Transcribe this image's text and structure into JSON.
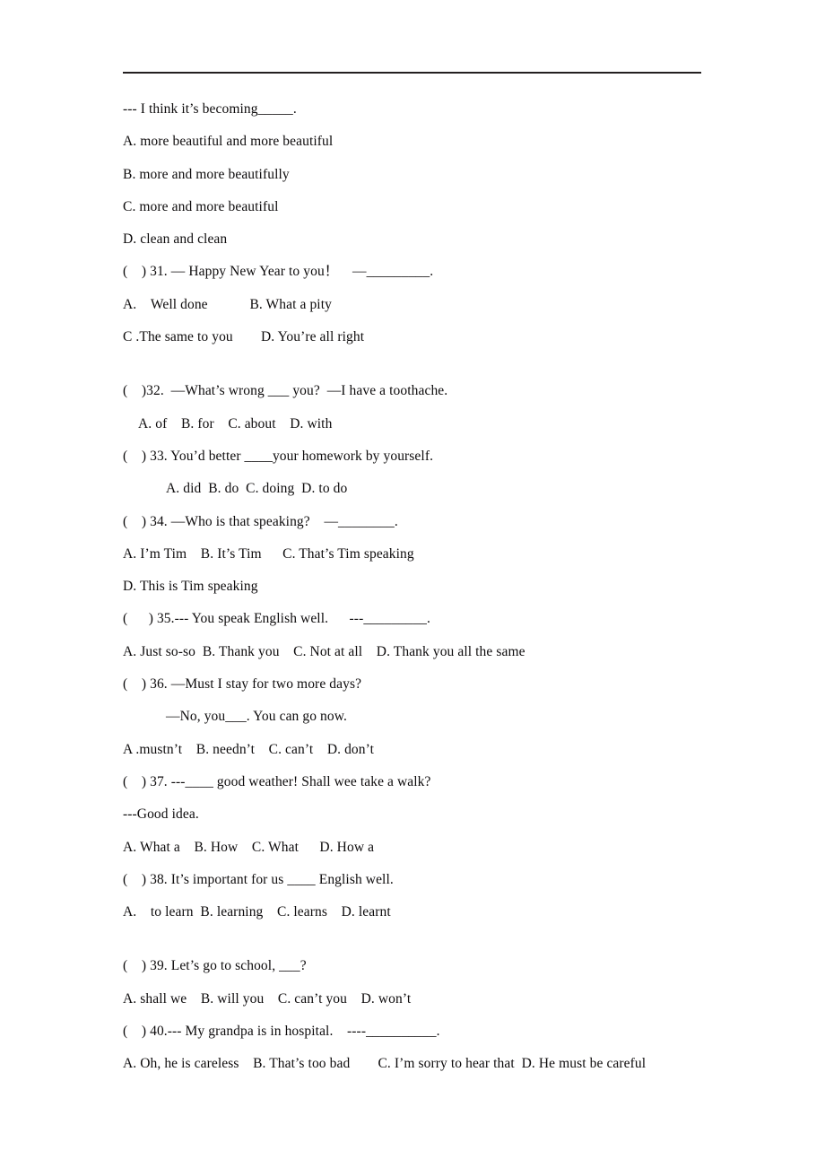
{
  "document": {
    "type": "english-exam-worksheet",
    "has_header_rule": true,
    "text_color": "#0d0b0c",
    "rule_color": "#231f20"
  },
  "lines": [
    {
      "id": "stem-30-prompt",
      "text": "--- I think it’s becoming_____."
    },
    {
      "id": "q30-option-a",
      "text": "A. more beautiful and more beautiful"
    },
    {
      "id": "q30-option-b",
      "text": "B. more and more beautifully"
    },
    {
      "id": "q30-option-c",
      "text": "C. more and more beautiful"
    },
    {
      "id": "q30-option-d",
      "text": "D. clean and clean"
    },
    {
      "id": "q31-stem",
      "text": "( ) 31. — Happy New Year to you！ —_________."
    },
    {
      "id": "q31-options-ab",
      "text": "A. Well done   B. What a pity"
    },
    {
      "id": "q31-options-cd",
      "text": "C .The same to you  D. You’re all right"
    },
    {
      "id": "q32-stem",
      "text": "( )32. —What’s wrong ___ you? —I have a toothache."
    },
    {
      "id": "q32-options",
      "text": "A. of B. for C. about D. with"
    },
    {
      "id": "q33-stem",
      "text": "( ) 33. You’d better ____your homework by yourself."
    },
    {
      "id": "q33-options",
      "text": "A. did B. do C. doing D. to do"
    },
    {
      "id": "q34-stem",
      "text": "( ) 34. —Who is that speaking?  —________."
    },
    {
      "id": "q34-options-abc",
      "text": "A. I’m Tim B. It’s Tim  C. That’s Tim speaking"
    },
    {
      "id": "q34-option-d",
      "text": "D. This is Tim speaking"
    },
    {
      "id": "q35-stem",
      "text": "(  ) 35.--- You speak English well.  ---_________."
    },
    {
      "id": "q35-options",
      "text": "A. Just so-so B. Thank you C. Not at all D. Thank you all the same"
    },
    {
      "id": "q36-stem",
      "text": "( ) 36. —Must I stay for two more days?"
    },
    {
      "id": "q36-stem-reply",
      "text": "—No, you___. You can go now."
    },
    {
      "id": "q36-options",
      "text": "A .mustn’t B. needn’t C. can’t D. don’t"
    },
    {
      "id": "q37-stem",
      "text": "( ) 37. ---____ good weather! Shall wee take a walk?"
    },
    {
      "id": "q37-stem-reply",
      "text": "---Good idea."
    },
    {
      "id": "q37-options",
      "text": "A. What a B. How C. What  D. How a"
    },
    {
      "id": "q38-stem",
      "text": "( ) 38. It’s important for us ____ English well."
    },
    {
      "id": "q38-options",
      "text": "A. to learn B. learning C. learns D. learnt"
    },
    {
      "id": "q39-stem",
      "text": "( ) 39. Let’s go to school, ___?"
    },
    {
      "id": "q39-options",
      "text": "A. shall we B. will you C. can’t you D. won’t"
    },
    {
      "id": "q40-stem",
      "text": "( ) 40.--- My grandpa is in hospital. ----__________."
    },
    {
      "id": "q40-options",
      "text": "A. Oh, he is careless B. That’s too bad  C. I’m sorry to hear that D. He must be careful"
    }
  ]
}
